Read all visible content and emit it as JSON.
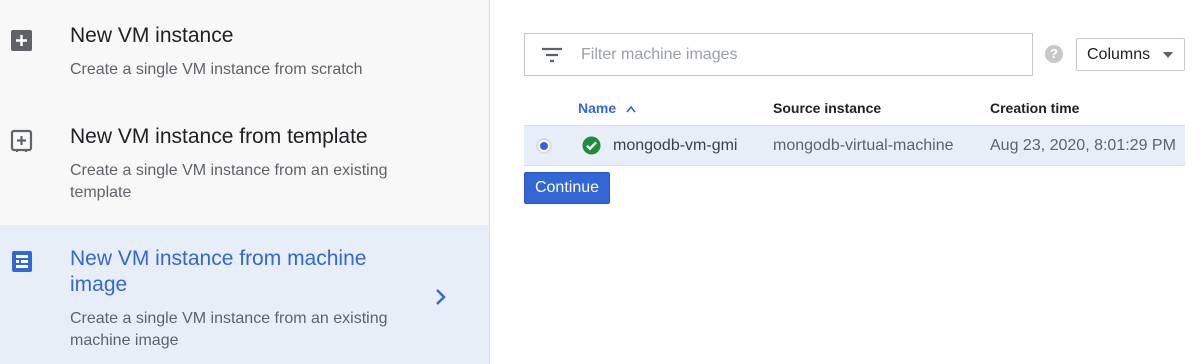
{
  "options": [
    {
      "title": "New VM instance",
      "description": "Create a single VM instance from scratch",
      "icon": "add-box-icon",
      "selected": false
    },
    {
      "title": "New VM instance from template",
      "description": "Create a single VM instance from an existing template",
      "icon": "template-add-icon",
      "selected": false
    },
    {
      "title": "New VM instance from machine image",
      "description": "Create a single VM instance from an existing machine image",
      "icon": "machine-image-icon",
      "selected": true
    }
  ],
  "filter": {
    "placeholder": "Filter machine images",
    "icon": "filter-icon"
  },
  "columns_button": {
    "label": "Columns"
  },
  "table": {
    "headers": {
      "name": "Name",
      "source": "Source instance",
      "created": "Creation time"
    },
    "rows": [
      {
        "name": "mongodb-vm-gmi",
        "source": "mongodb-virtual-machine",
        "created": "Aug 23, 2020, 8:01:29 PM",
        "selected": true,
        "status": "ok"
      }
    ]
  },
  "continue_button": {
    "label": "Continue"
  },
  "colors": {
    "accent": "#3367d6",
    "selected_bg": "#e8eef8",
    "status_ok": "#1e8e3e"
  }
}
